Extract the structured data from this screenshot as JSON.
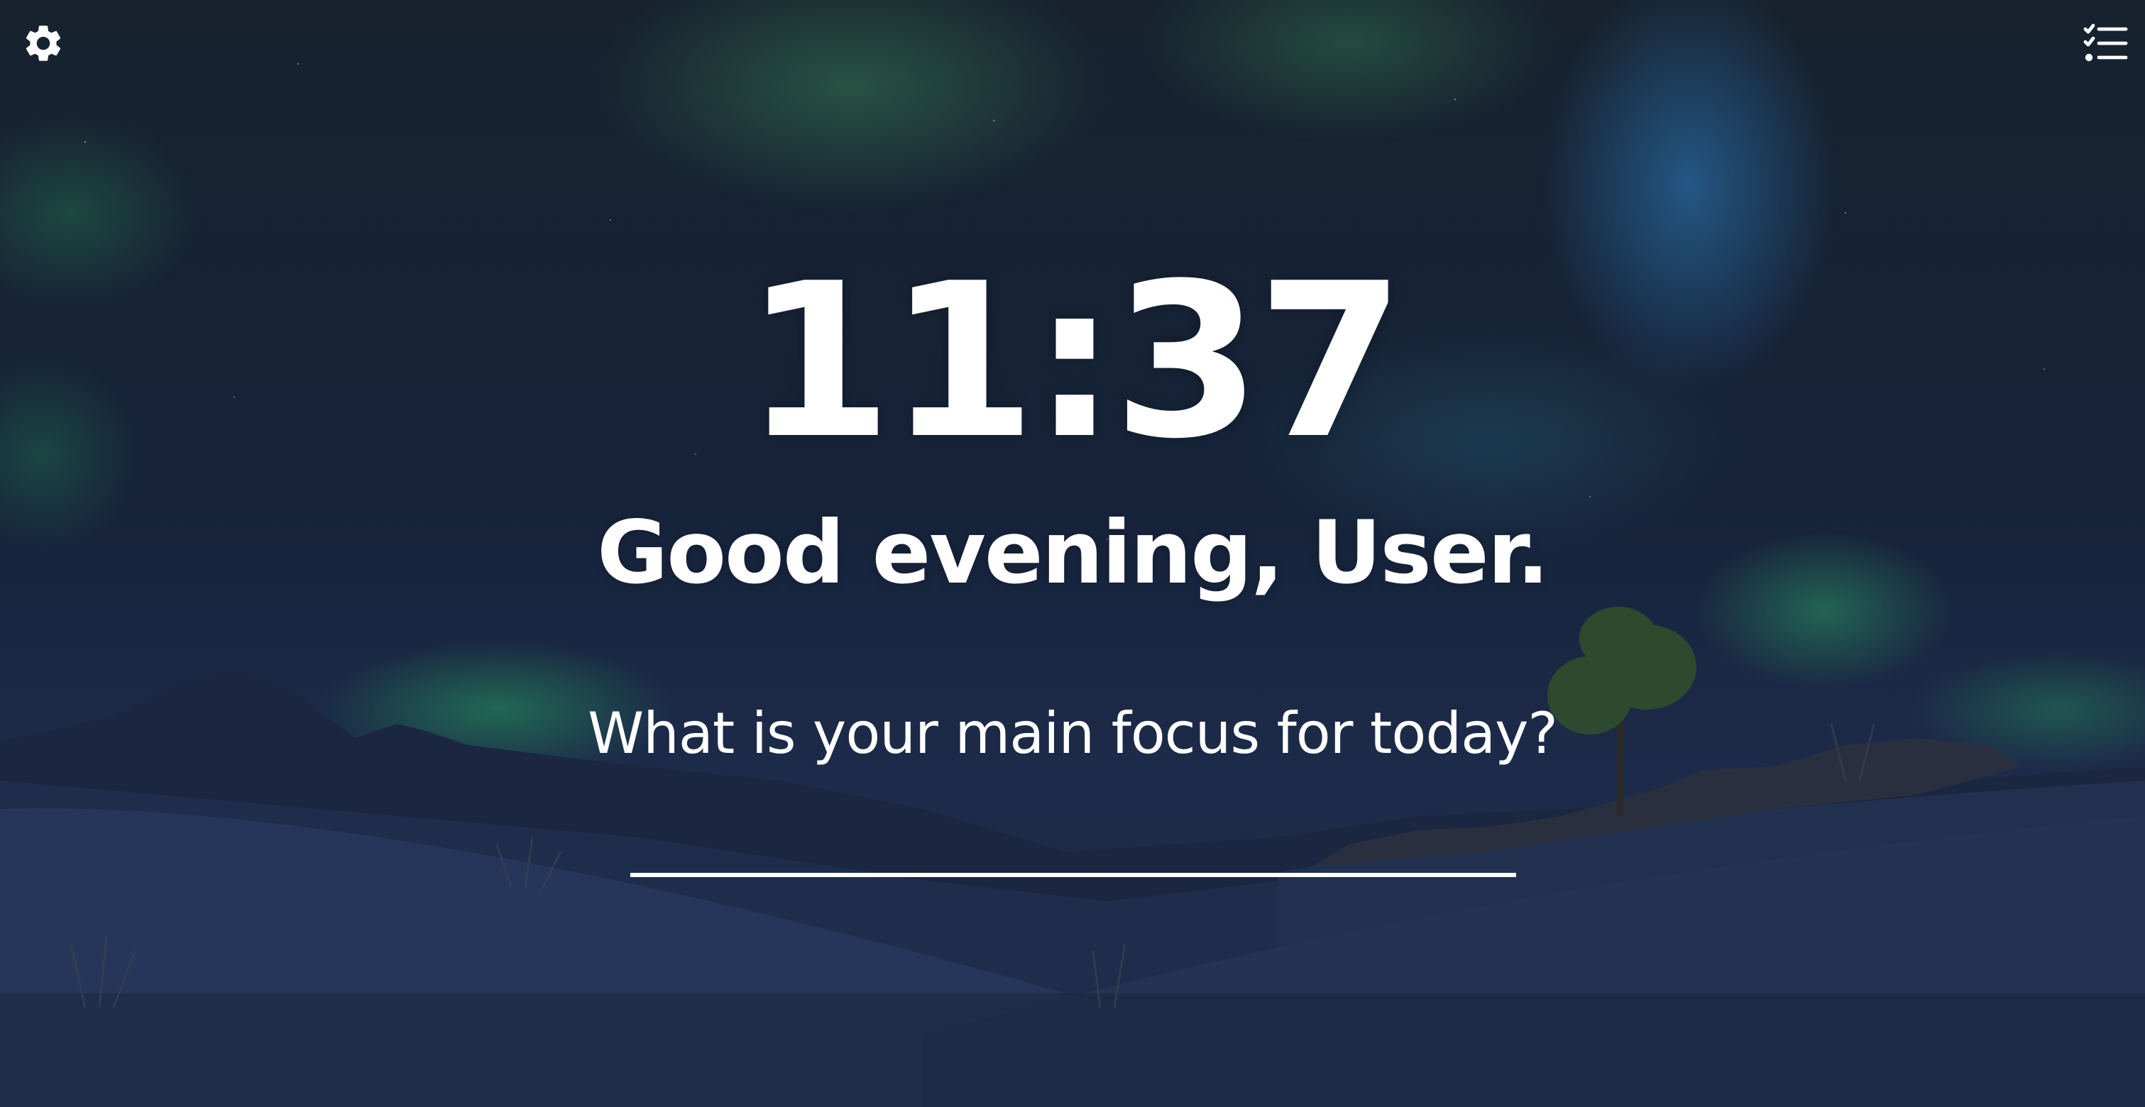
{
  "header": {
    "settings_icon": "gear-icon",
    "todo_icon": "checklist-icon"
  },
  "main": {
    "time": "11:37",
    "greeting": "Good evening, User.",
    "focus_prompt": "What is your main focus for today?",
    "focus_value": "",
    "focus_placeholder": ""
  },
  "colors": {
    "text": "#ffffff",
    "sky_top": "#17222e",
    "sky_bottom": "#1d2b4a",
    "aurora_green": "#2cb46a",
    "aurora_blue": "#2d82c8"
  }
}
